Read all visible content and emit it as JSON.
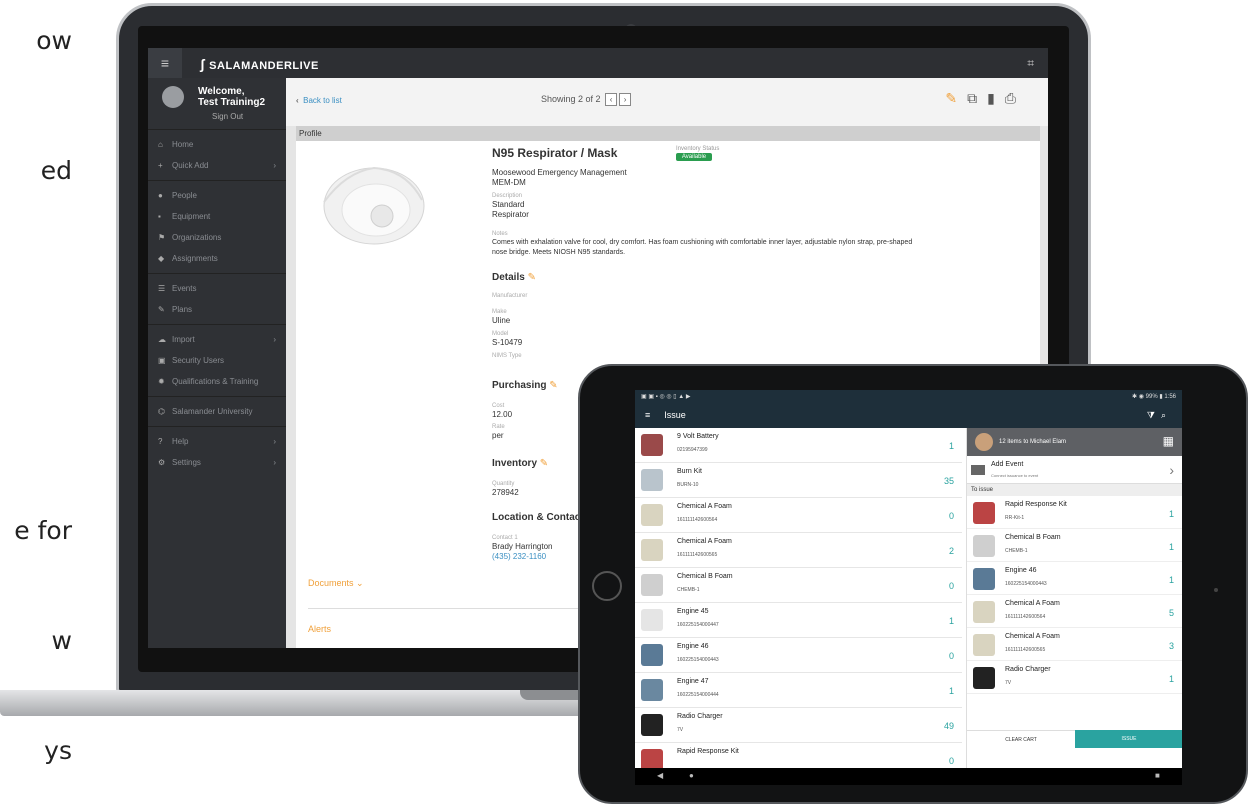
{
  "left_text": [
    "ow",
    "ed",
    "e for",
    "w",
    "ys"
  ],
  "laptop": {
    "brand": "SALAMANDERLIVE",
    "user": {
      "welcome_line1": "Welcome,",
      "welcome_line2": "Test Training2",
      "sign_out": "Sign Out"
    },
    "sidebar_items": [
      {
        "label": "Home",
        "icon": "home-icon"
      },
      {
        "label": "Quick Add",
        "icon": "plus-icon"
      },
      {
        "label": "People",
        "icon": "person-icon"
      },
      {
        "label": "Equipment",
        "icon": "equipment-icon"
      },
      {
        "label": "Organizations",
        "icon": "flag-icon"
      },
      {
        "label": "Assignments",
        "icon": "tag-icon"
      },
      {
        "label": "Events",
        "icon": "list-icon"
      },
      {
        "label": "Plans",
        "icon": "edit-icon"
      },
      {
        "label": "Import",
        "icon": "cloud-icon"
      },
      {
        "label": "Security Users",
        "icon": "lock-icon"
      },
      {
        "label": "Qualifications & Training",
        "icon": "award-icon"
      },
      {
        "label": "Salamander University",
        "icon": "bank-icon"
      },
      {
        "label": "Help",
        "icon": "question-icon"
      },
      {
        "label": "Settings",
        "icon": "gear-icon"
      }
    ],
    "back_label": "Back to list",
    "showing": "Showing 2 of 2",
    "panel_title": "Profile",
    "item": {
      "title": "N95 Respirator / Mask",
      "inventory_status_label": "Inventory Status",
      "inventory_status": "Available",
      "org": "Moosewood Emergency Management",
      "code": "MEM-DM",
      "description_label": "Description",
      "description_1": "Standard",
      "description_2": "Respirator",
      "notes_label": "Notes",
      "notes_1": "Comes with exhalation valve for cool, dry comfort. Has foam cushioning with comfortable inner layer, adjustable nylon strap, pre-shaped",
      "notes_2": "nose bridge. Meets NIOSH N95 standards."
    },
    "details": {
      "heading": "Details",
      "manufacturer_label": "Manufacturer",
      "make_label": "Make",
      "make": "Uline",
      "model_label": "Model",
      "model": "S-10479",
      "nims_label": "NIMS Type"
    },
    "purchasing": {
      "heading": "Purchasing",
      "cost_label": "Cost",
      "cost": "12.00",
      "rate_label": "Rate",
      "rate": "per"
    },
    "inventory": {
      "heading": "Inventory",
      "quantity_label": "Quantity",
      "quantity": "278942"
    },
    "location": {
      "heading": "Location & Contact",
      "contact_label": "Contact 1",
      "contact_name": "Brady Harrington",
      "contact_phone": "(435) 232-1160"
    },
    "documents_label": "Documents",
    "alerts_label": "Alerts"
  },
  "tablet": {
    "title": "Issue",
    "battery": "99%",
    "time": "1:56",
    "items": [
      {
        "name": "9 Volt Battery",
        "sub": "02195947399",
        "qty": "1"
      },
      {
        "name": "Burn Kit",
        "sub": "BURN-10",
        "qty": "35"
      },
      {
        "name": "Chemical A Foam",
        "sub": "161111142600564",
        "qty": "0"
      },
      {
        "name": "Chemical A Foam",
        "sub": "161111142600565",
        "qty": "2"
      },
      {
        "name": "Chemical B Foam",
        "sub": "CHEMB-1",
        "qty": "0"
      },
      {
        "name": "Engine 45",
        "sub": "160225154000447",
        "qty": "1"
      },
      {
        "name": "Engine 46",
        "sub": "160225154000443",
        "qty": "0"
      },
      {
        "name": "Engine 47",
        "sub": "160225154000444",
        "qty": "1"
      },
      {
        "name": "Radio Charger",
        "sub": "7V",
        "qty": "49"
      },
      {
        "name": "Rapid Response Kit",
        "sub": "",
        "qty": "0"
      }
    ],
    "cart_header": "12 items to Michael Elam",
    "add_event": "Add Event",
    "add_event_sub": "Connect issuance to event",
    "to_issue": "To issue",
    "cart_items": [
      {
        "name": "Rapid Response Kit",
        "sub": "RR-Kit-1",
        "qty": "1"
      },
      {
        "name": "Chemical B Foam",
        "sub": "CHEMB-1",
        "qty": "1"
      },
      {
        "name": "Engine 46",
        "sub": "160225154000443",
        "qty": "1"
      },
      {
        "name": "Chemical A Foam",
        "sub": "161111142600564",
        "qty": "5"
      },
      {
        "name": "Chemical A Foam",
        "sub": "161111142600565",
        "qty": "3"
      },
      {
        "name": "Radio Charger",
        "sub": "7V",
        "qty": "1"
      }
    ],
    "clear_cart": "CLEAR CART",
    "issue": "ISSUE"
  }
}
